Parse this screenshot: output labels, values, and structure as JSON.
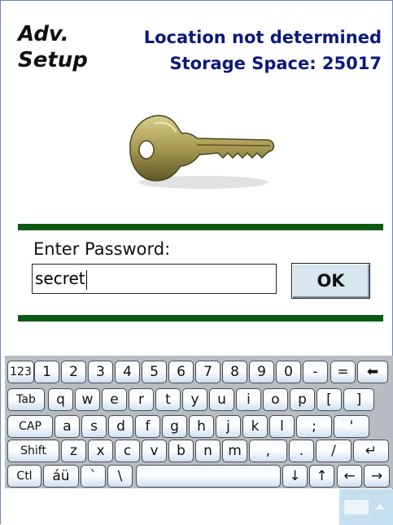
{
  "header": {
    "title_line1": "Adv.",
    "title_line2": "Setup",
    "location_status": "Location not determined",
    "storage_space": "Storage Space: 25017"
  },
  "password": {
    "label": "Enter Password:",
    "value": "secret",
    "ok_label": "OK"
  },
  "colors": {
    "title_text": "#0b1a7a",
    "divider_green": "#0b5a14",
    "keyboard_bg": "#b7bdc3",
    "ok_button_bg": "#d8e6f0"
  },
  "keyboard": {
    "rows": [
      [
        "123",
        "1",
        "2",
        "3",
        "4",
        "5",
        "6",
        "7",
        "8",
        "9",
        "0",
        "-",
        "=",
        "⬅"
      ],
      [
        "Tab",
        "q",
        "w",
        "e",
        "r",
        "t",
        "y",
        "u",
        "i",
        "o",
        "p",
        "[",
        "]"
      ],
      [
        "CAP",
        "a",
        "s",
        "d",
        "f",
        "g",
        "h",
        "j",
        "k",
        "l",
        ";",
        "'"
      ],
      [
        "Shift",
        "z",
        "x",
        "c",
        "v",
        "b",
        "n",
        "m",
        ",",
        ".",
        "/",
        "↵"
      ],
      [
        "Ctl",
        "áü",
        "`",
        "\\",
        "",
        "↓",
        "↑",
        "←",
        "→"
      ]
    ]
  },
  "sip_icon": "keyboard-icon"
}
